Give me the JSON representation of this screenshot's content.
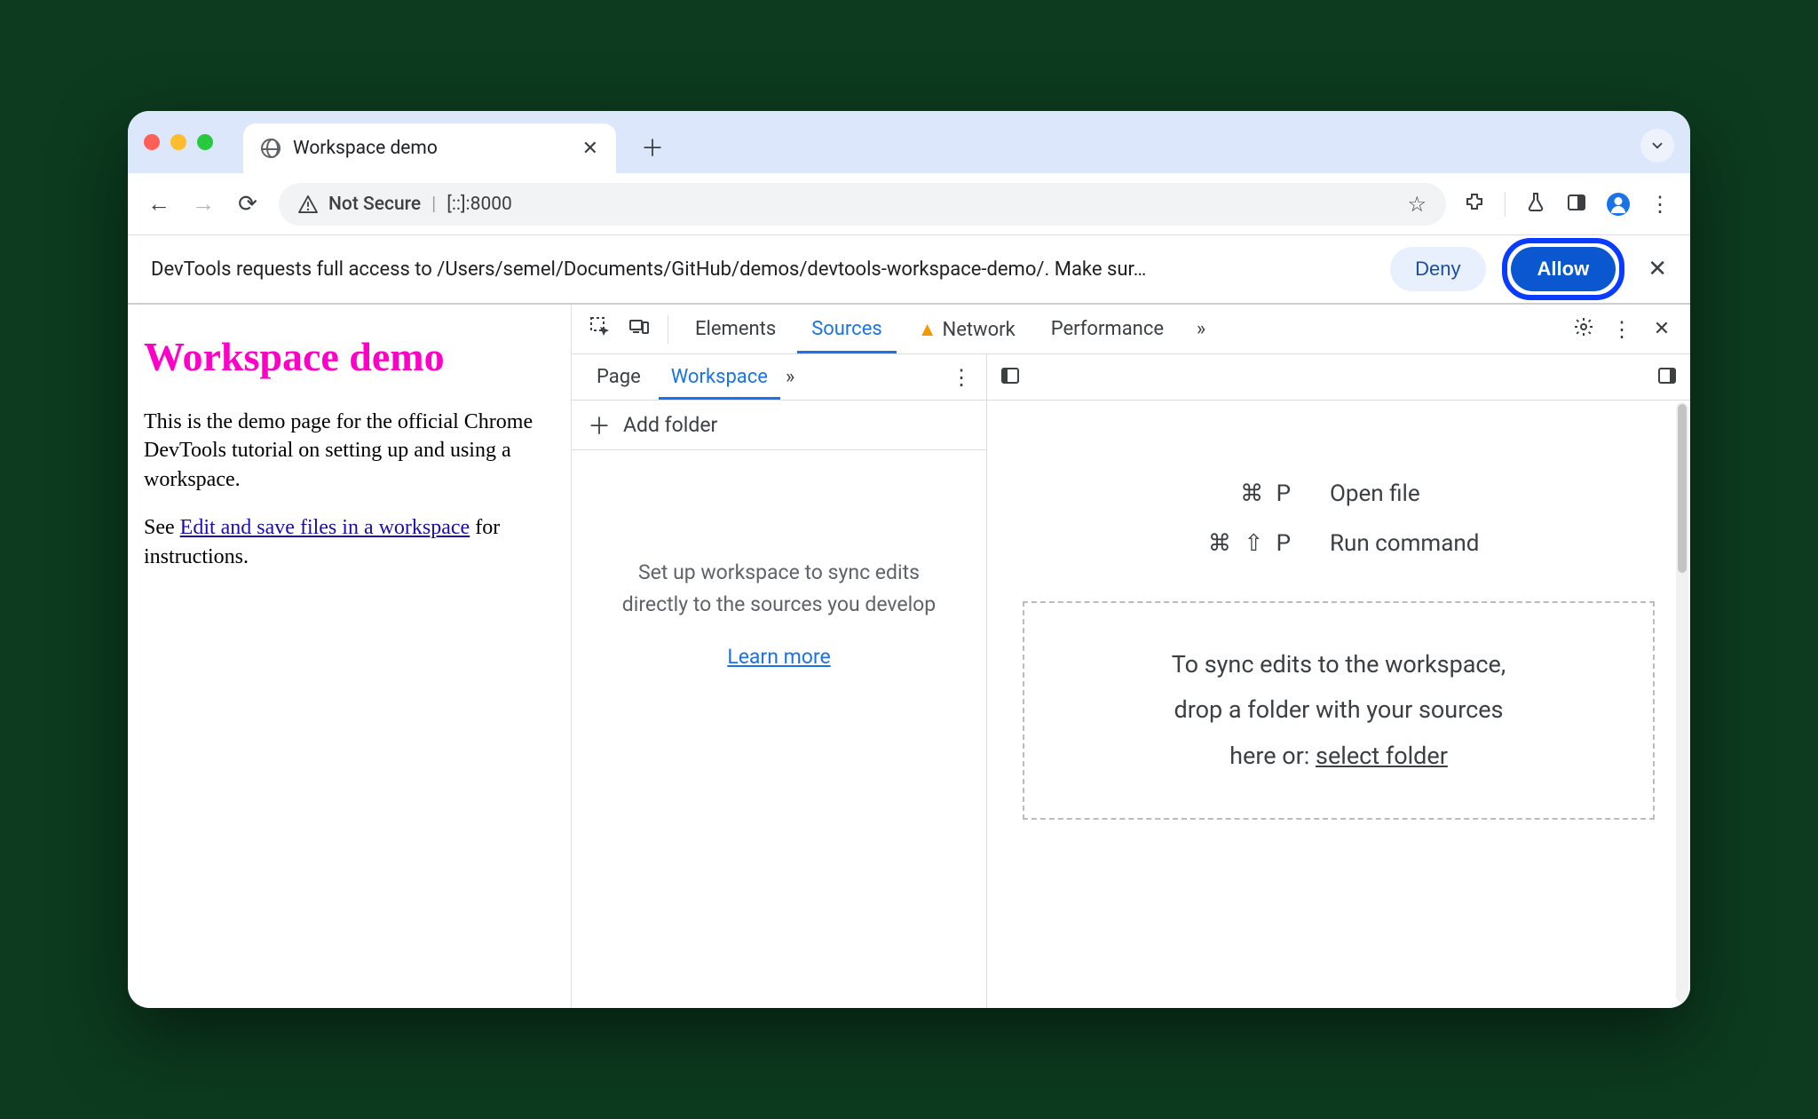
{
  "browser": {
    "tab_title": "Workspace demo",
    "security_label": "Not Secure",
    "url": "[::]:8000"
  },
  "permission": {
    "message": "DevTools requests full access to /Users/semel/Documents/GitHub/demos/devtools-workspace-demo/. Make sur…",
    "deny": "Deny",
    "allow": "Allow"
  },
  "page": {
    "heading": "Workspace demo",
    "para1": "This is the demo page for the official Chrome DevTools tutorial on setting up and using a workspace.",
    "para2_prefix": "See ",
    "para2_link": "Edit and save files in a workspace",
    "para2_suffix": " for instructions."
  },
  "devtools": {
    "tabs": {
      "elements": "Elements",
      "sources": "Sources",
      "network": "Network",
      "performance": "Performance"
    },
    "subtabs": {
      "page": "Page",
      "workspace": "Workspace"
    },
    "add_folder": "Add folder",
    "workspace_hint": "Set up workspace to sync edits directly to the sources you develop",
    "learn_more": "Learn more",
    "shortcuts": {
      "open_file_keys": "⌘ P",
      "open_file_label": "Open file",
      "run_cmd_keys": "⌘ ⇧ P",
      "run_cmd_label": "Run command"
    },
    "dropzone_line1": "To sync edits to the workspace,",
    "dropzone_line2": "drop a folder with your sources",
    "dropzone_line3_prefix": "here or: ",
    "dropzone_select": "select folder"
  }
}
